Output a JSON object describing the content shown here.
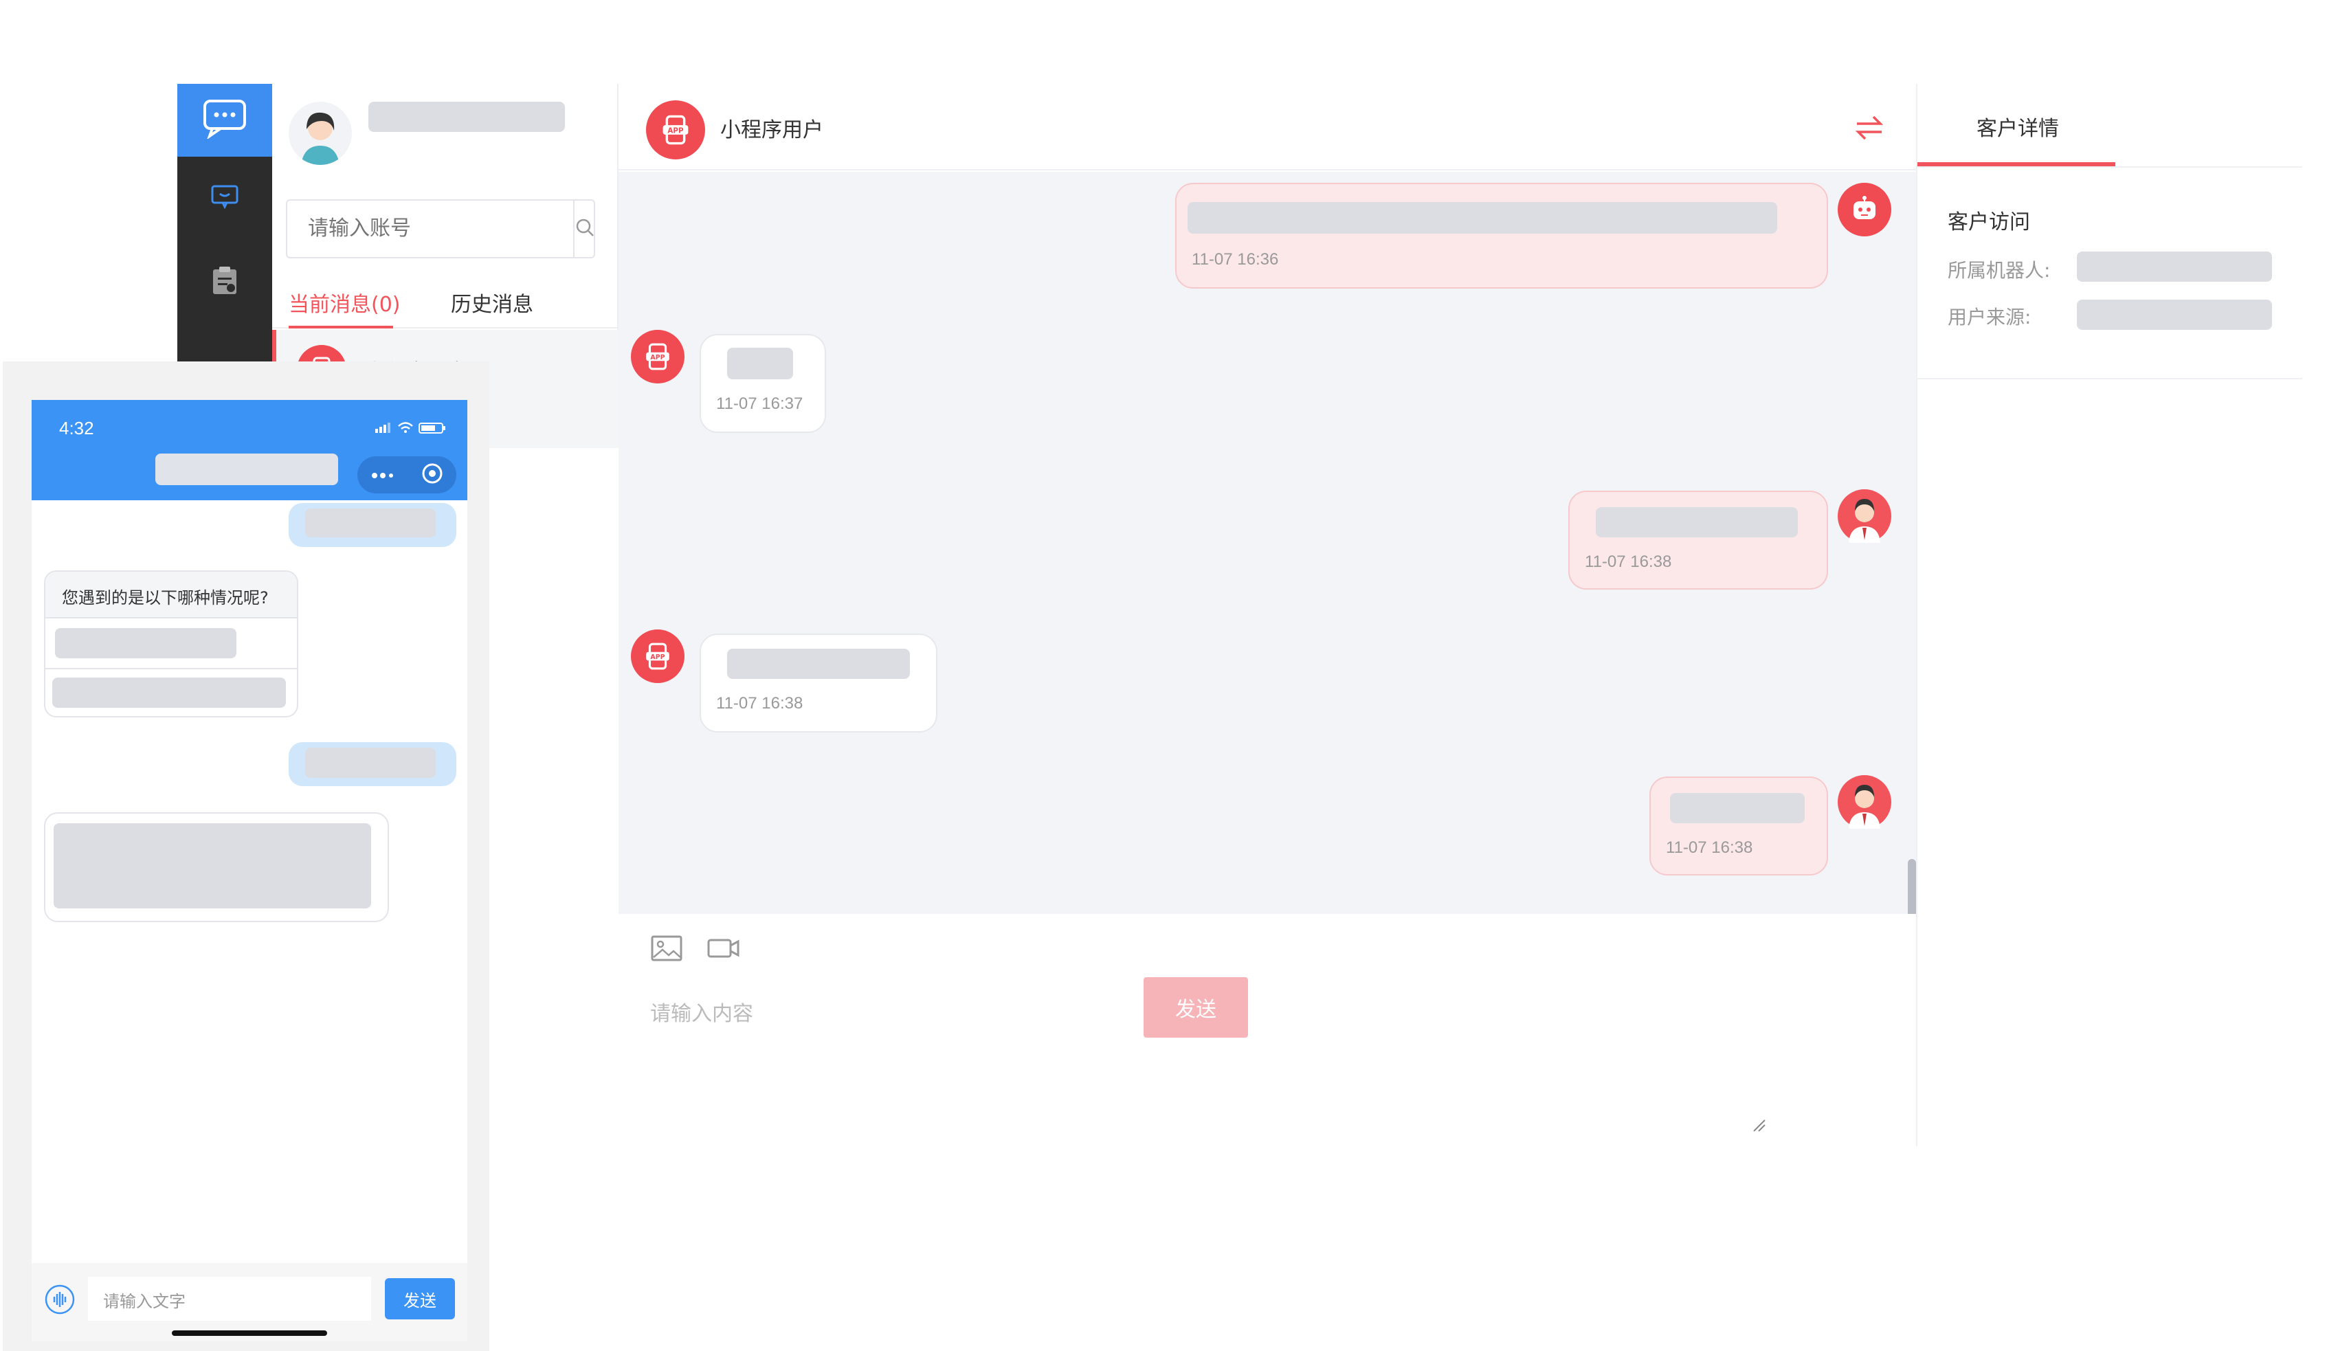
{
  "colors": {
    "accent_red": "#f2545b",
    "accent_blue": "#3c93f6",
    "rail_bg": "#2c2c2c"
  },
  "contacts": {
    "search_placeholder": "请输入账号",
    "tabs": [
      "当前消息(0)",
      "历史消息"
    ],
    "conversation_label": "小程序用户"
  },
  "chat": {
    "title": "小程序用户",
    "messages": [
      {
        "from": "robot",
        "time": "11-07 16:36"
      },
      {
        "from": "user",
        "time": "11-07 16:37"
      },
      {
        "from": "agent",
        "time": "11-07 16:38"
      },
      {
        "from": "user",
        "time": "11-07 16:38"
      },
      {
        "from": "agent",
        "time": "11-07 16:38"
      }
    ],
    "input_placeholder": "请输入内容",
    "send_label": "发送"
  },
  "detail": {
    "tab": "客户详情",
    "section": "客户访问",
    "fields": [
      "所属机器人:",
      "用户来源:"
    ]
  },
  "phone": {
    "time": "4:32",
    "question": "您遇到的是以下哪种情况呢?",
    "input_placeholder": "请输入文字",
    "send_label": "发送"
  }
}
